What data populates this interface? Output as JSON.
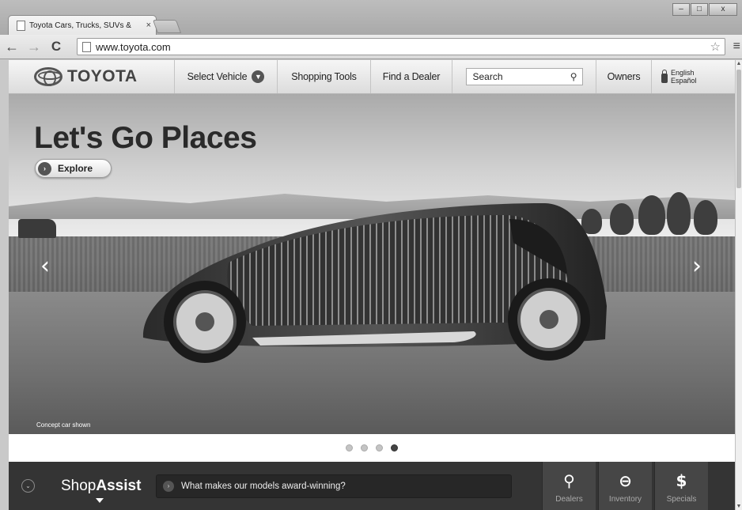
{
  "browser": {
    "tab_title": "Toyota Cars, Trucks, SUVs &",
    "tab_close": "×",
    "url": "www.toyota.com",
    "back": "←",
    "forward": "→",
    "reload": "C",
    "star": "☆",
    "menu": "≡"
  },
  "window_controls": {
    "minimize": "–",
    "maximize": "□",
    "close": "x"
  },
  "site_nav": {
    "brand": "TOYOTA",
    "select_vehicle": "Select Vehicle",
    "shopping_tools": "Shopping Tools",
    "find_dealer": "Find a Dealer",
    "search_placeholder": "Search",
    "owners": "Owners",
    "lang_english": "English",
    "lang_espanol": "Español"
  },
  "hero": {
    "headline": "Let's Go Places",
    "cta": "Explore",
    "caption": "Concept car shown",
    "prev": "‹",
    "next": "›",
    "slide_count": 4,
    "active_slide": 4
  },
  "shop_assist": {
    "logo_light": "Shop",
    "logo_bold": "Assist",
    "question": "What makes our models award-winning?",
    "actions": [
      {
        "label": "Dealers",
        "icon": "map-pin-icon"
      },
      {
        "label": "Inventory",
        "icon": "car-search-icon"
      },
      {
        "label": "Specials",
        "icon": "price-tag-icon"
      }
    ]
  }
}
